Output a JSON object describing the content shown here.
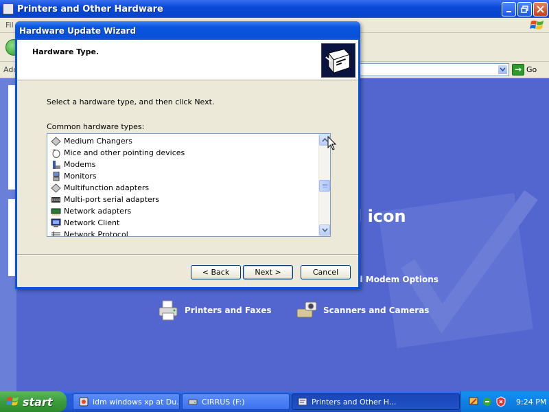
{
  "background_window": {
    "title": "Printers and Other Hardware",
    "menu_file_fragment": "Fil",
    "address_fragment": "Add",
    "go_label": "Go",
    "heading_fragment": "l icon",
    "modem_fragment": "d Modem Options",
    "items": [
      {
        "label": "Printers and Faxes",
        "icon": "printer-fax-icon"
      },
      {
        "label": "Scanners and Cameras",
        "icon": "scanner-camera-icon"
      }
    ]
  },
  "wizard": {
    "title": "Hardware Update Wizard",
    "header_title": "Hardware Type.",
    "instruction": "Select a hardware type, and then click Next.",
    "list_label": "Common hardware types:",
    "hardware_types": [
      {
        "label": "Medium Changers",
        "icon": "medium-changer-icon"
      },
      {
        "label": "Mice and other pointing devices",
        "icon": "mouse-icon"
      },
      {
        "label": "Modems",
        "icon": "modem-icon"
      },
      {
        "label": "Monitors",
        "icon": "monitor-icon"
      },
      {
        "label": "Multifunction adapters",
        "icon": "multifunction-adapter-icon"
      },
      {
        "label": "Multi-port serial adapters",
        "icon": "serial-adapter-icon"
      },
      {
        "label": "Network adapters",
        "icon": "network-adapter-icon"
      },
      {
        "label": "Network Client",
        "icon": "network-client-icon"
      },
      {
        "label": "Network Protocol",
        "icon": "network-protocol-icon"
      }
    ],
    "buttons": {
      "back": "< Back",
      "next": "Next >",
      "cancel": "Cancel"
    }
  },
  "taskbar": {
    "start_label": "start",
    "tasks": [
      {
        "label": "idm windows xp at Du...",
        "active": false,
        "icon": "browser-icon"
      },
      {
        "label": "CIRRUS (F:)",
        "active": false,
        "icon": "drive-icon"
      },
      {
        "label": "Printers and Other H...",
        "active": true,
        "icon": "printer-folder-icon"
      }
    ],
    "clock": "9:24 PM"
  },
  "colors": {
    "xp_blue": "#0a52d8",
    "dialog_face": "#ece9d8",
    "content_bg": "#5366cf",
    "start_green": "#3c9c3c"
  }
}
